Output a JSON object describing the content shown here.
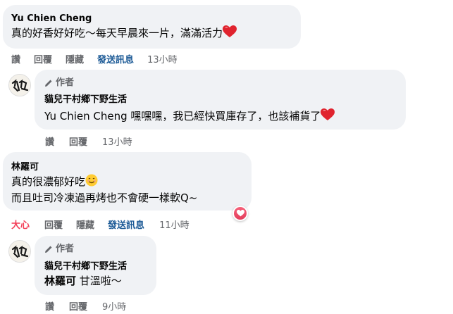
{
  "comments": [
    {
      "name": "Yu Chien Cheng",
      "text": "真的好香好好吃～每天早晨來一片，滿滿活力",
      "actions": {
        "like": "讚",
        "reply": "回覆",
        "hide": "隱藏",
        "message": "發送訊息",
        "time": "13小時"
      }
    },
    {
      "author_badge": "作者",
      "name": "貓兒干村鄉下野生活",
      "mention": "Yu Chien Cheng",
      "text": " 嘿嘿嘿，我已經快買庫存了，也該補貨了",
      "actions": {
        "like": "讚",
        "reply": "回覆",
        "time": "13小時"
      }
    },
    {
      "name": "林羅可",
      "line1": "真的很濃郁好吃",
      "line2": "而且吐司冷凍過再烤也不會硬一樣軟Q~",
      "actions": {
        "like": "大心",
        "reply": "回覆",
        "hide": "隱藏",
        "message": "發送訊息",
        "time": "11小時"
      }
    },
    {
      "author_badge": "作者",
      "name": "貓兒干村鄉下野生活",
      "mention": "林羅可",
      "text": " 甘溫啦～",
      "actions": {
        "like": "讚",
        "reply": "回覆",
        "time": "9小時"
      }
    }
  ],
  "colors": {
    "bubble": "#f0f2f5",
    "muted": "#65676b",
    "link": "#1c5a96",
    "love": "#f33e58"
  },
  "icons": [
    "pencil-icon",
    "heart-emoji-icon",
    "smile-emoji-icon",
    "love-reaction-icon",
    "page-avatar"
  ]
}
